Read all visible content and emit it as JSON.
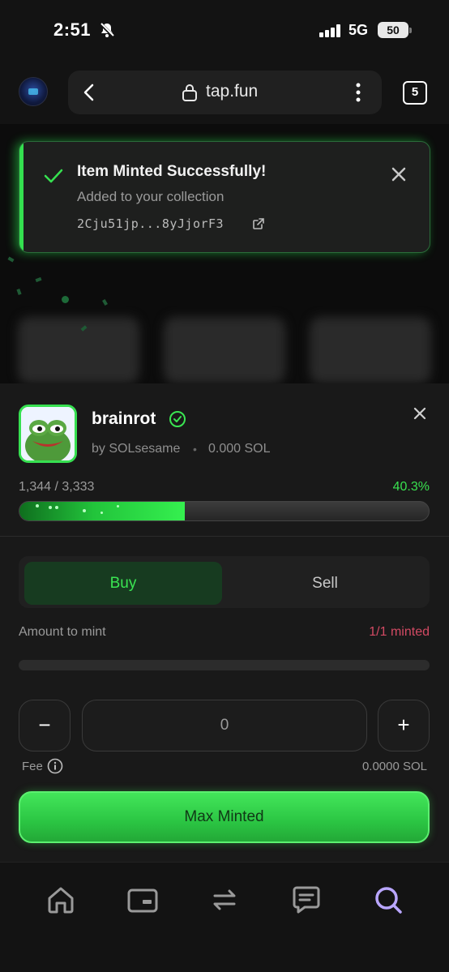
{
  "status_bar": {
    "time": "2:51",
    "network": "5G",
    "battery": "50"
  },
  "browser": {
    "url": "tap.fun",
    "tab_count": "5"
  },
  "toast": {
    "title": "Item Minted Successfully!",
    "subtitle": "Added to your collection",
    "tx_hash": "2Cju51jp...8yJjorF3"
  },
  "collection": {
    "name": "brainrot",
    "creator": "by SOLsesame",
    "separator": "•",
    "price": "0.000 SOL",
    "progress_count": "1,344 / 3,333",
    "progress_percent": "40.3%",
    "progress_fraction": 0.403
  },
  "trade": {
    "buy_label": "Buy",
    "sell_label": "Sell",
    "amount_label": "Amount to mint",
    "minted_status": "1/1 minted",
    "quantity": "0",
    "decrement": "−",
    "increment": "+",
    "fee_label": "Fee",
    "fee_value": "0.0000 SOL",
    "action_label": "Max Minted"
  },
  "colors": {
    "accent_green": "#39e04f",
    "warning_red": "#d24a63",
    "active_nav": "#b9a6ff"
  },
  "nav": [
    "home-icon",
    "wallet-icon",
    "swap-icon",
    "chat-icon",
    "search-icon"
  ]
}
